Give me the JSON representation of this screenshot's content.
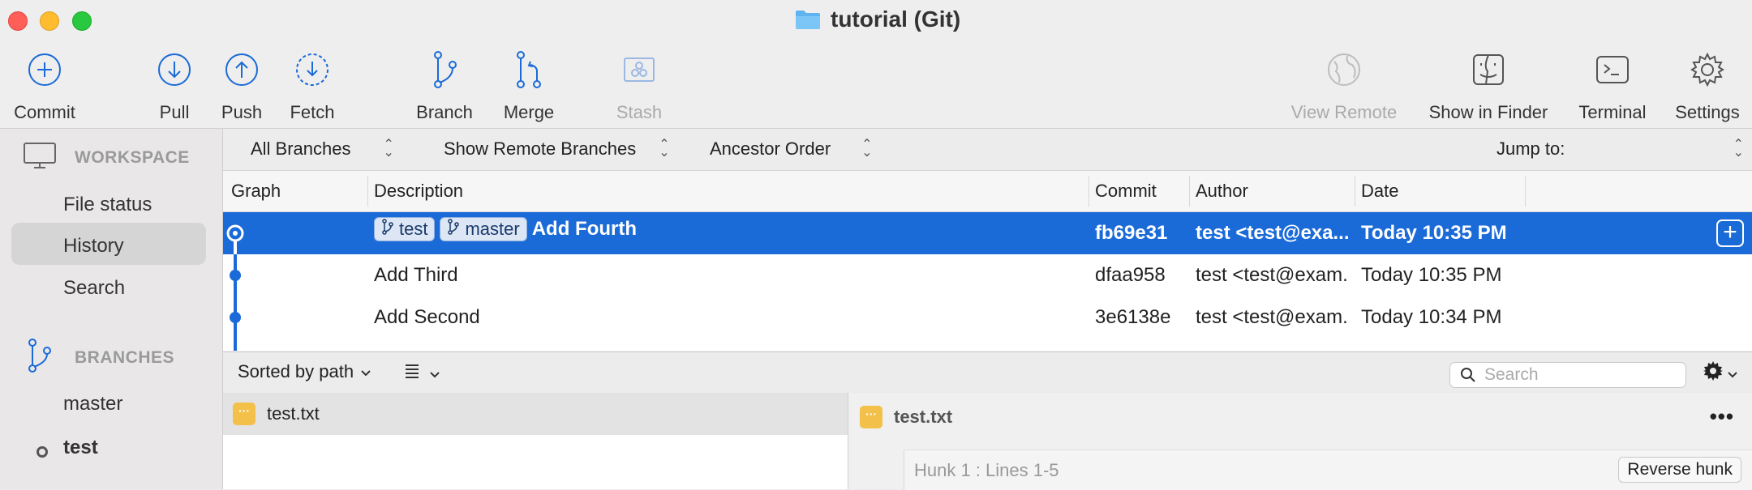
{
  "window": {
    "title": "tutorial (Git)"
  },
  "toolbar": {
    "commit": "Commit",
    "pull": "Pull",
    "push": "Push",
    "fetch": "Fetch",
    "branch": "Branch",
    "merge": "Merge",
    "stash": "Stash",
    "view_remote": "View Remote",
    "show_in_finder": "Show in Finder",
    "terminal": "Terminal",
    "settings": "Settings"
  },
  "sidebar": {
    "workspace_header": "WORKSPACE",
    "workspace_items": [
      "File status",
      "History",
      "Search"
    ],
    "selected": "History",
    "branches_header": "BRANCHES",
    "branches": [
      "master",
      "test"
    ],
    "current_branch": "test"
  },
  "filters": {
    "branches": "All Branches",
    "remote": "Show Remote Branches",
    "order": "Ancestor Order",
    "jump_to": "Jump to:"
  },
  "table": {
    "columns": [
      "Graph",
      "Description",
      "Commit",
      "Author",
      "Date"
    ],
    "rows": [
      {
        "tags": [
          "test",
          "master"
        ],
        "description": "Add Fourth",
        "commit": "fb69e31",
        "author": "test <test@exa...",
        "date": "Today 10:35 PM",
        "selected": true
      },
      {
        "tags": [],
        "description": "Add Third",
        "commit": "dfaa958",
        "author": "test <test@exam...",
        "date": "Today 10:35 PM",
        "selected": false
      },
      {
        "tags": [],
        "description": "Add Second",
        "commit": "3e6138e",
        "author": "test <test@exam...",
        "date": "Today 10:34 PM",
        "selected": false
      }
    ]
  },
  "files": {
    "sort_label": "Sorted by path",
    "search_placeholder": "Search",
    "items": [
      "test.txt"
    ]
  },
  "diff": {
    "file": "test.txt",
    "hunk_label": "Hunk 1 : Lines 1-5",
    "reverse_hunk": "Reverse hunk"
  },
  "colors": {
    "accent": "#1a6ad8",
    "file_badge": "#f3c04a"
  }
}
